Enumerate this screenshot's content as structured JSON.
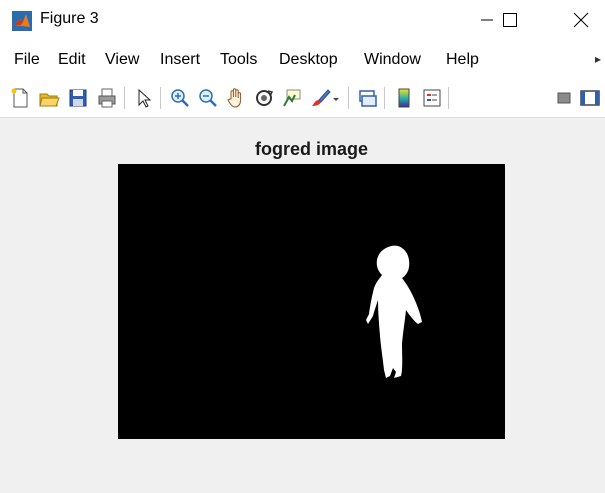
{
  "window": {
    "title": "Figure 3",
    "controls": [
      "minimize",
      "maximize",
      "close"
    ]
  },
  "menu": {
    "items": [
      "File",
      "Edit",
      "View",
      "Insert",
      "Tools",
      "Desktop",
      "Window",
      "Help"
    ]
  },
  "toolbar": {
    "icons": [
      "new-figure-icon",
      "open-file-icon",
      "save-icon",
      "print-icon",
      "pointer-icon",
      "zoom-in-icon",
      "zoom-out-icon",
      "pan-hand-icon",
      "rotate-3d-icon",
      "data-cursor-icon",
      "brush-icon",
      "brush-dropdown-icon",
      "link-plot-icon",
      "colorbar-icon",
      "legend-icon",
      "hide-plot-tools-icon",
      "show-plot-tools-icon"
    ]
  },
  "figure": {
    "title": "fogred image",
    "image_description_colors": {
      "background": "#000000",
      "foreground": "#ffffff"
    }
  }
}
